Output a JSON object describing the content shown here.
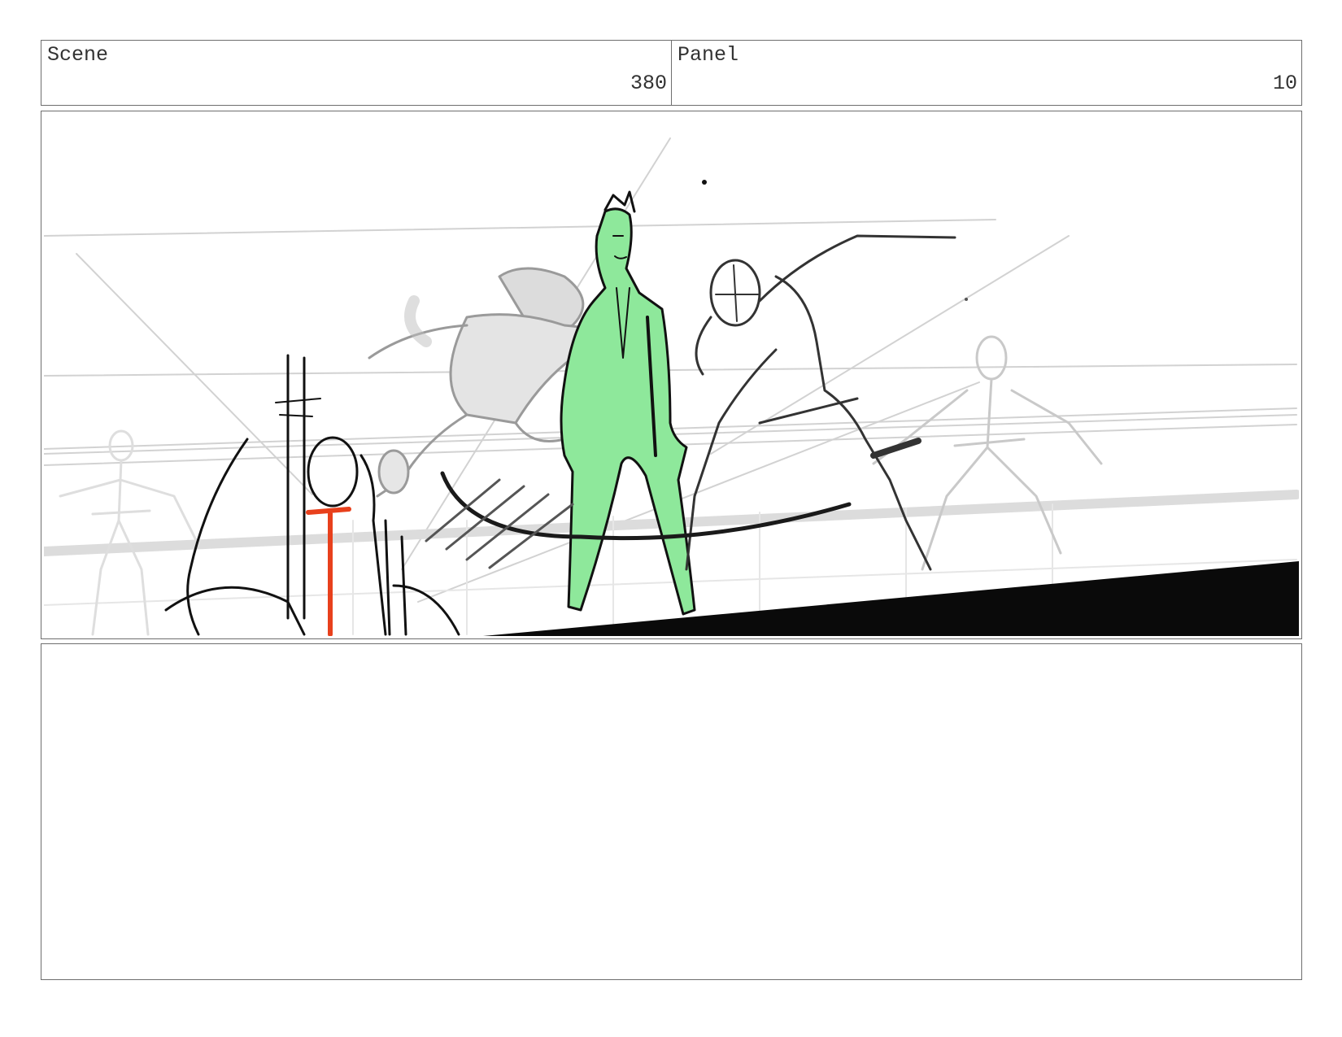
{
  "header": {
    "scene_label": "Scene",
    "scene_value": "380",
    "panel_label": "Panel",
    "panel_value": "10"
  },
  "artwork": {
    "subject": "sketch-fight-scene",
    "highlight_color": "#8ee89b",
    "accent_color": "#e8401c"
  },
  "notes": {
    "text": ""
  }
}
